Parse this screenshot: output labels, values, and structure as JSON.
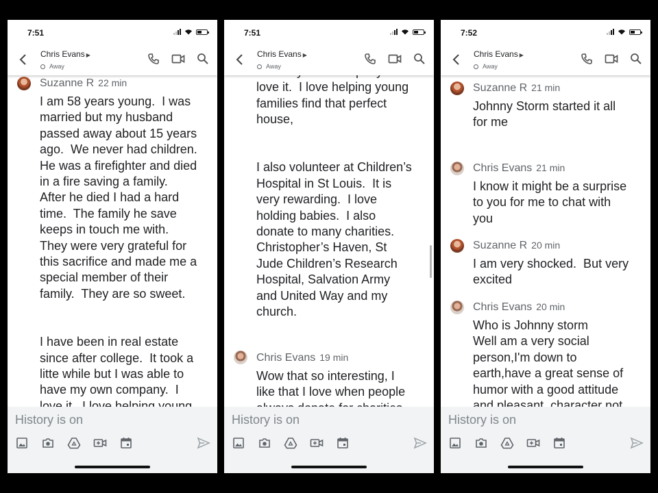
{
  "colors": {
    "background": "#000000",
    "screen": "#ffffff",
    "composer": "#f1f3f4",
    "text": "#202124",
    "muted": "#5f6368"
  },
  "icons": [
    "back-arrow-icon",
    "phone-icon",
    "video-icon",
    "search-icon",
    "image-icon",
    "camera-icon",
    "drive-icon",
    "video-add-icon",
    "calendar-icon",
    "send-icon"
  ],
  "phones": [
    {
      "time": "7:51",
      "contact": "Chris Evans",
      "status": "Away",
      "composer_placeholder": "History is on",
      "messages": [
        {
          "author": "Suzanne R",
          "time": "22 min",
          "text": "I am 58 years young.  I was\nmarried but my husband\npassed away about 15 years\nago.  We never had children.\nHe was a firefighter and died\nin a fire saving a family.\nAfter he died I had a hard\ntime.  The family he save\nkeeps in touch me with.\nThey were very grateful for\nthis sacrifice and made me a\nspecial member of their\nfamily.  They are so sweet.\n\n\nI have been in real estate\nsince after college.  It took a\nlitte while but I was able to\nhave my own company.  I\nlove it.  I love helping young"
        }
      ]
    },
    {
      "time": "7:51",
      "contact": "Chris Evans",
      "status": "Away",
      "composer_placeholder": "History is on",
      "partial_text": "have my own company.  I\nlove it.  I love helping young\nfamilies find that perfect\nhouse,\n\n\nI also volunteer at Children’s\nHospital in St Louis.  It is\nvery rewarding.  I love\nholding babies.  I also\ndonate to many charities.\nChristopher’s Haven, St\nJude Children’s Research\nHospital, Salvation Army\nand United Way and my\nchurch.",
      "messages": [
        {
          "author": "Chris Evans",
          "time": "19 min",
          "text": "Wow that so interesting, I\nlike that I love when people\nalways donate for charities"
        }
      ]
    },
    {
      "time": "7:52",
      "contact": "Chris Evans",
      "status": "Away",
      "composer_placeholder": "History is on",
      "messages": [
        {
          "author": "Suzanne R",
          "time": "21 min",
          "text": "Johnny Storm started it all\nfor me"
        },
        {
          "author": "Chris Evans",
          "time": "21 min",
          "text": "I know it might be a surprise\nto you for me to chat with\nyou"
        },
        {
          "author": "Suzanne R",
          "time": "20 min",
          "text": "I am very shocked.  But very\nexcited"
        },
        {
          "author": "Chris Evans",
          "time": "20 min",
          "text": "Who is Johnny storm\nWell am a very social\nperson,I'm down to\nearth,have a great sense of\nhumor with a good attitude\nand pleasant  character not\nonly in words but in deeds. I"
        }
      ]
    }
  ]
}
